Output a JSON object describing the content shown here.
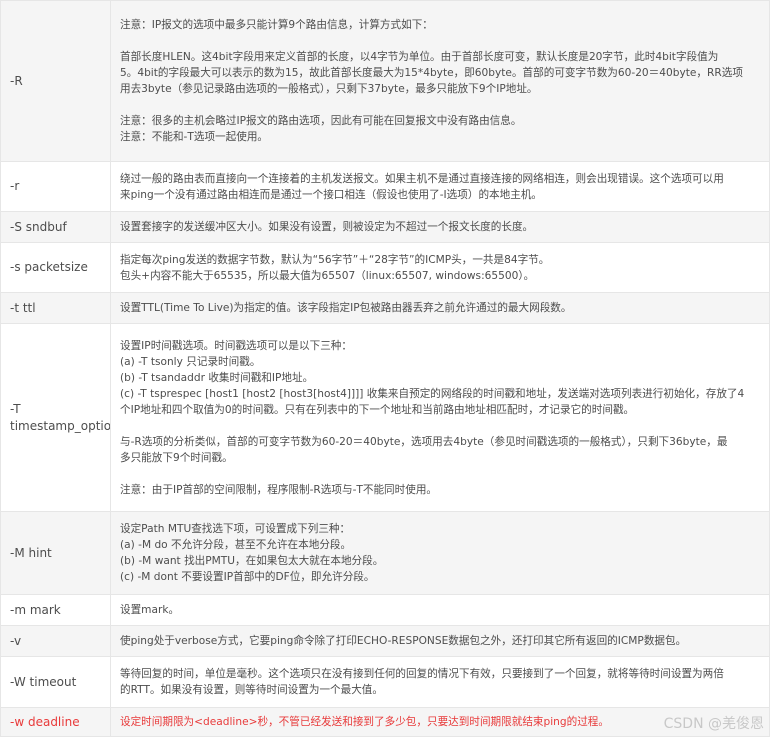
{
  "rows": [
    {
      "option": "-R",
      "paragraphs": [
        [
          "注意：IP报文的选项中最多只能计算9个路由信息，计算方式如下："
        ],
        [
          "首部长度HLEN。这4bit字段用来定义首部的长度，以4字节为单位。由于首部长度可变，默认长度是20字节，此时4bit字段值为",
          "5。4bit的字段最大可以表示的数为15，故此首部长度最大为15*4byte，即60byte。首部的可变字节数为60-20＝40byte，RR选项",
          "用去3byte（参见记录路由选项的一般格式），只剩下37byte，最多只能放下9个IP地址。"
        ],
        [
          "注意：很多的主机会略过IP报文的路由选项，因此有可能在回复报文中没有路由信息。",
          "注意：不能和-T选项一起使用。"
        ]
      ]
    },
    {
      "option": "-r",
      "paragraphs": [
        [
          "绕过一般的路由表而直接向一个连接着的主机发送报文。如果主机不是通过直接连接的网络相连，则会出现错误。这个选项可以用",
          "来ping一个没有通过路由相连而是通过一个接口相连（假设也使用了-I选项）的本地主机。"
        ]
      ]
    },
    {
      "option": "-S sndbuf",
      "paragraphs": [
        [
          "设置套接字的发送缓冲区大小。如果没有设置，则被设定为不超过一个报文长度的长度。"
        ]
      ]
    },
    {
      "option": "-s packetsize",
      "paragraphs": [
        [
          "指定每次ping发送的数据字节数，默认为“56字节”＋“28字节”的ICMP头，一共是84字节。",
          "包头+内容不能大于65535，所以最大值为65507（linux:65507, windows:65500）。"
        ]
      ]
    },
    {
      "option": "-t ttl",
      "paragraphs": [
        [
          "设置TTL(Time To Live)为指定的值。该字段指定IP包被路由器丢弃之前允许通过的最大网段数。"
        ]
      ]
    },
    {
      "option_lines": [
        "-T",
        "timestamp_option"
      ],
      "paragraphs": [
        [
          "设置IP时间戳选项。时间戳选项可以是以下三种：",
          "(a) -T tsonly 只记录时间戳。",
          "(b) -T tsandaddr 收集时间戳和IP地址。",
          "(c) -T tsprespec [host1 [host2 [host3[host4]]]] 收集来自预定的网络段的时间戳和地址，发送端对选项列表进行初始化，存放了4",
          "个IP地址和四个取值为0的时间戳。只有在列表中的下一个地址和当前路由地址相匹配时，才记录它的时间戳。"
        ],
        [
          "与-R选项的分析类似，首部的可变字节数为60-20＝40byte，选项用去4byte（参见时间戳选项的一般格式），只剩下36byte，最",
          "多只能放下9个时间戳。"
        ],
        [
          "注意：由于IP首部的空间限制，程序限制-R选项与-T不能同时使用。"
        ]
      ]
    },
    {
      "option": "-M hint",
      "paragraphs": [
        [
          "设定Path MTU查找选下项，可设置成下列三种：",
          "(a) -M do 不允许分段，甚至不允许在本地分段。",
          "(b) -M want 找出PMTU，在如果包太大就在本地分段。",
          "(c) -M dont 不要设置IP首部中的DF位，即允许分段。"
        ]
      ]
    },
    {
      "option": "-m mark",
      "paragraphs": [
        [
          "设置mark。"
        ]
      ]
    },
    {
      "option": "-v",
      "paragraphs": [
        [
          "使ping处于verbose方式，它要ping命令除了打印ECHO-RESPONSE数据包之外，还打印其它所有返回的ICMP数据包。"
        ]
      ]
    },
    {
      "option": "-W timeout",
      "paragraphs": [
        [
          "等待回复的时间，单位是毫秒。这个选项只在没有接到任何的回复的情况下有效，只要接到了一个回复，就将等待时间设置为两倍",
          "的RTT。如果没有设置，则等待时间设置为一个最大值。"
        ]
      ]
    },
    {
      "option": "-w deadline",
      "paragraphs": [
        [
          "设定时间期限为<deadline>秒，不管已经发送和接到了多少包，只要达到时间期限就结束ping的过程。"
        ]
      ]
    }
  ],
  "watermark": "CSDN @羌俊恩"
}
